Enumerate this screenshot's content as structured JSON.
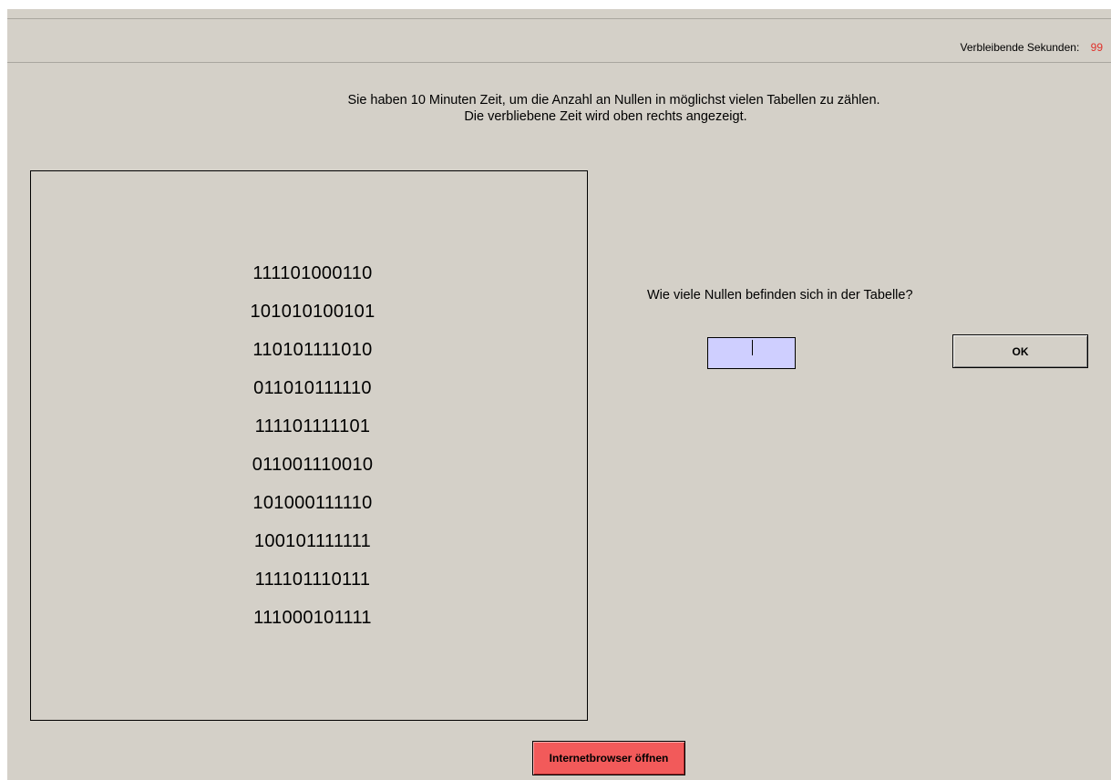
{
  "timer": {
    "label": "Verbleibende Sekunden:",
    "value": "99"
  },
  "instructions": {
    "line1": "Sie haben 10 Minuten Zeit, um die Anzahl an Nullen in möglichst vielen Tabellen zu zählen.",
    "line2": "Die verbliebene Zeit wird oben rechts angezeigt."
  },
  "table": {
    "rows": [
      "111101000110",
      "101010100101",
      "110101111010",
      "011010111110",
      "111101111101",
      "011001110010",
      "101000111110",
      "100101111111",
      "111101110111",
      "111000101111"
    ]
  },
  "question": {
    "text": "Wie viele Nullen befinden sich in der Tabelle?",
    "answer_value": ""
  },
  "buttons": {
    "ok_label": "OK",
    "browser_label": "Internetbrowser öffnen"
  },
  "colors": {
    "background": "#d4d0c8",
    "timer_value": "#e0302a",
    "input_background": "#cfcfff",
    "browser_button": "#f25a5a"
  }
}
